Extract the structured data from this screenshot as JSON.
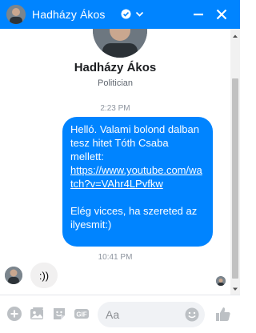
{
  "header": {
    "contact_name": "Hadházy Ákos",
    "verified_icon": "verified-badge-icon",
    "chevron_icon": "chevron-down-icon",
    "minimize_icon": "minimize-icon",
    "close_icon": "close-icon",
    "background_color": "#0084ff"
  },
  "profile": {
    "name": "Hadházy Ákos",
    "subtitle": "Politician"
  },
  "messages": {
    "timestamp_1": "2:23 PM",
    "outgoing": {
      "line1": "Helló. Valami bolond dalban tesz hitet Tóth Csaba mellett:",
      "link": "https://www.youtube.com/watch?v=VAhr4LPvfkw",
      "line2": "Elég vicces, ha szereted az ilyesmit:)",
      "bubble_color": "#0084ff"
    },
    "timestamp_2": "10:41 PM",
    "incoming": {
      "text": ":))",
      "bubble_color": "#f1f0f0"
    }
  },
  "composer": {
    "placeholder": "Aa",
    "icons": [
      "plus-icon",
      "image-icon",
      "sticker-icon",
      "gif-icon",
      "emoji-icon",
      "like-icon"
    ],
    "gif_label": "GIF",
    "accent_color": "#0084ff"
  }
}
